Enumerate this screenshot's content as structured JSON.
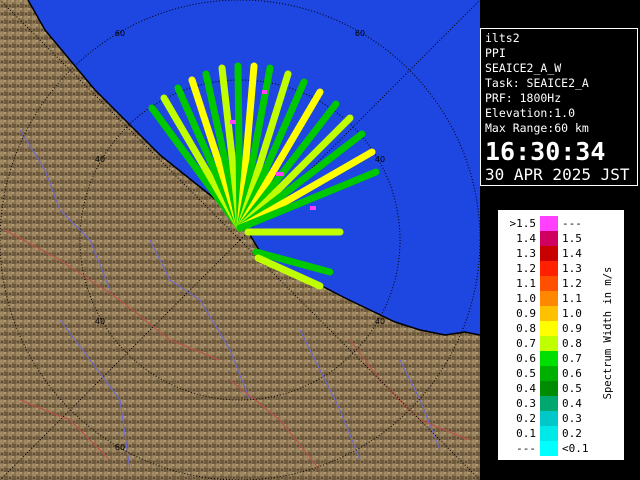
{
  "info": {
    "radar": "ilts2",
    "product": "PPI",
    "scan": "SEAICE2_A_W",
    "task": "Task: SEAICE2_A",
    "prf": "PRF: 1800Hz",
    "elevation": "Elevation:1.0",
    "max_range": "Max Range:60 km",
    "time": "16:30:34",
    "date": "30 APR 2025 JST"
  },
  "range_labels": [
    "60",
    "60",
    "40",
    "40",
    "40",
    "40",
    "60"
  ],
  "legend": {
    "title": "Spectrum Width in m/s",
    "rows": [
      {
        "label": ">1.5",
        "range": "---",
        "color": "#ff40ff"
      },
      {
        "label": "1.4",
        "range": "1.5",
        "color": "#d00060"
      },
      {
        "label": "1.3",
        "range": "1.4",
        "color": "#c80000"
      },
      {
        "label": "1.2",
        "range": "1.3",
        "color": "#ff2000"
      },
      {
        "label": "1.1",
        "range": "1.2",
        "color": "#ff5000"
      },
      {
        "label": "1.0",
        "range": "1.1",
        "color": "#ff8800"
      },
      {
        "label": "0.9",
        "range": "1.0",
        "color": "#ffc000"
      },
      {
        "label": "0.8",
        "range": "0.9",
        "color": "#ffff00"
      },
      {
        "label": "0.7",
        "range": "0.8",
        "color": "#c0ff00"
      },
      {
        "label": "0.6",
        "range": "0.7",
        "color": "#00e000"
      },
      {
        "label": "0.5",
        "range": "0.6",
        "color": "#00b000"
      },
      {
        "label": "0.4",
        "range": "0.5",
        "color": "#008c00"
      },
      {
        "label": "0.3",
        "range": "0.4",
        "color": "#00a870"
      },
      {
        "label": "0.2",
        "range": "0.3",
        "color": "#00c8c8"
      },
      {
        "label": "0.1",
        "range": "0.2",
        "color": "#00e8e8"
      },
      {
        "label": "---",
        "range": "<0.1",
        "color": "#00ffff"
      }
    ]
  }
}
